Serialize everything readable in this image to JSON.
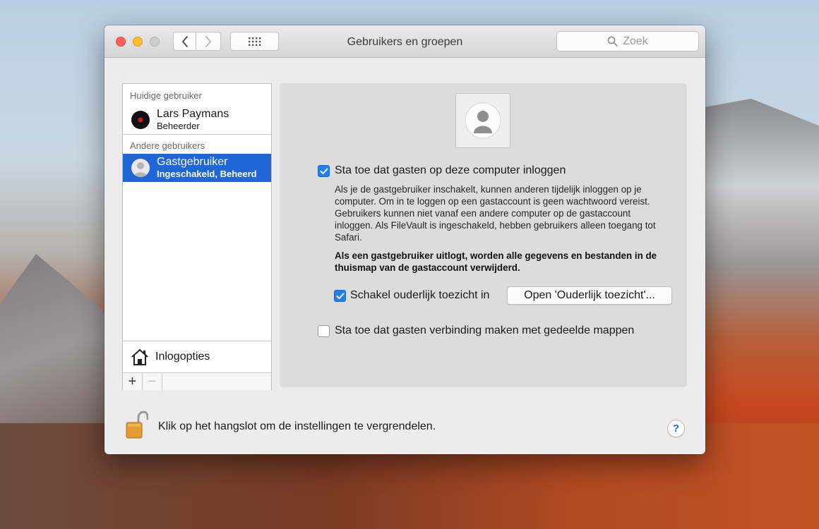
{
  "window": {
    "title": "Gebruikers en groepen"
  },
  "toolbar": {
    "search_placeholder": "Zoek",
    "back_icon": "chevron-left-icon",
    "forward_icon": "chevron-right-icon",
    "grid_icon": "grid-icon"
  },
  "userlist": {
    "current_header": "Huidige gebruiker",
    "current_user": {
      "name": "Lars Paymans",
      "role": "Beheerder"
    },
    "other_header": "Andere gebruikers",
    "other_users": [
      {
        "name": "Gastgebruiker",
        "role": "Ingeschakeld, Beheerd",
        "selected": true
      }
    ],
    "login_options_label": "Inlogopties",
    "add_label": "+",
    "remove_label": "−"
  },
  "detail": {
    "allow_guest_login": {
      "label": "Sta toe dat gasten op deze computer inloggen",
      "checked": true
    },
    "description": "Als je de gastgebruiker inschakelt, kunnen anderen tijdelijk inloggen op je computer. Om in te loggen op een gastaccount is geen wachtwoord vereist. Gebruikers kunnen niet vanaf een andere computer op de gastaccount inloggen. Als FileVault is ingeschakeld, hebben gebruikers alleen toegang tot Safari.",
    "warning": "Als een gastgebruiker uitlogt, worden alle gegevens en bestanden in de thuismap van de gastaccount verwijderd.",
    "parental_controls": {
      "label": "Schakel ouderlijk toezicht in",
      "checked": true,
      "button_label": "Open 'Ouderlijk toezicht'..."
    },
    "shared_folders": {
      "label": "Sta toe dat gasten verbinding maken met gedeelde mappen",
      "checked": false
    }
  },
  "footer": {
    "lock_text": "Klik op het hangslot om de instellingen te vergrendelen.",
    "help_label": "?"
  },
  "colors": {
    "selection": "#1f66d6",
    "checkbox_checked": "#1f7ff1",
    "close": "#fc5f57",
    "minimize": "#fdbc2e"
  }
}
